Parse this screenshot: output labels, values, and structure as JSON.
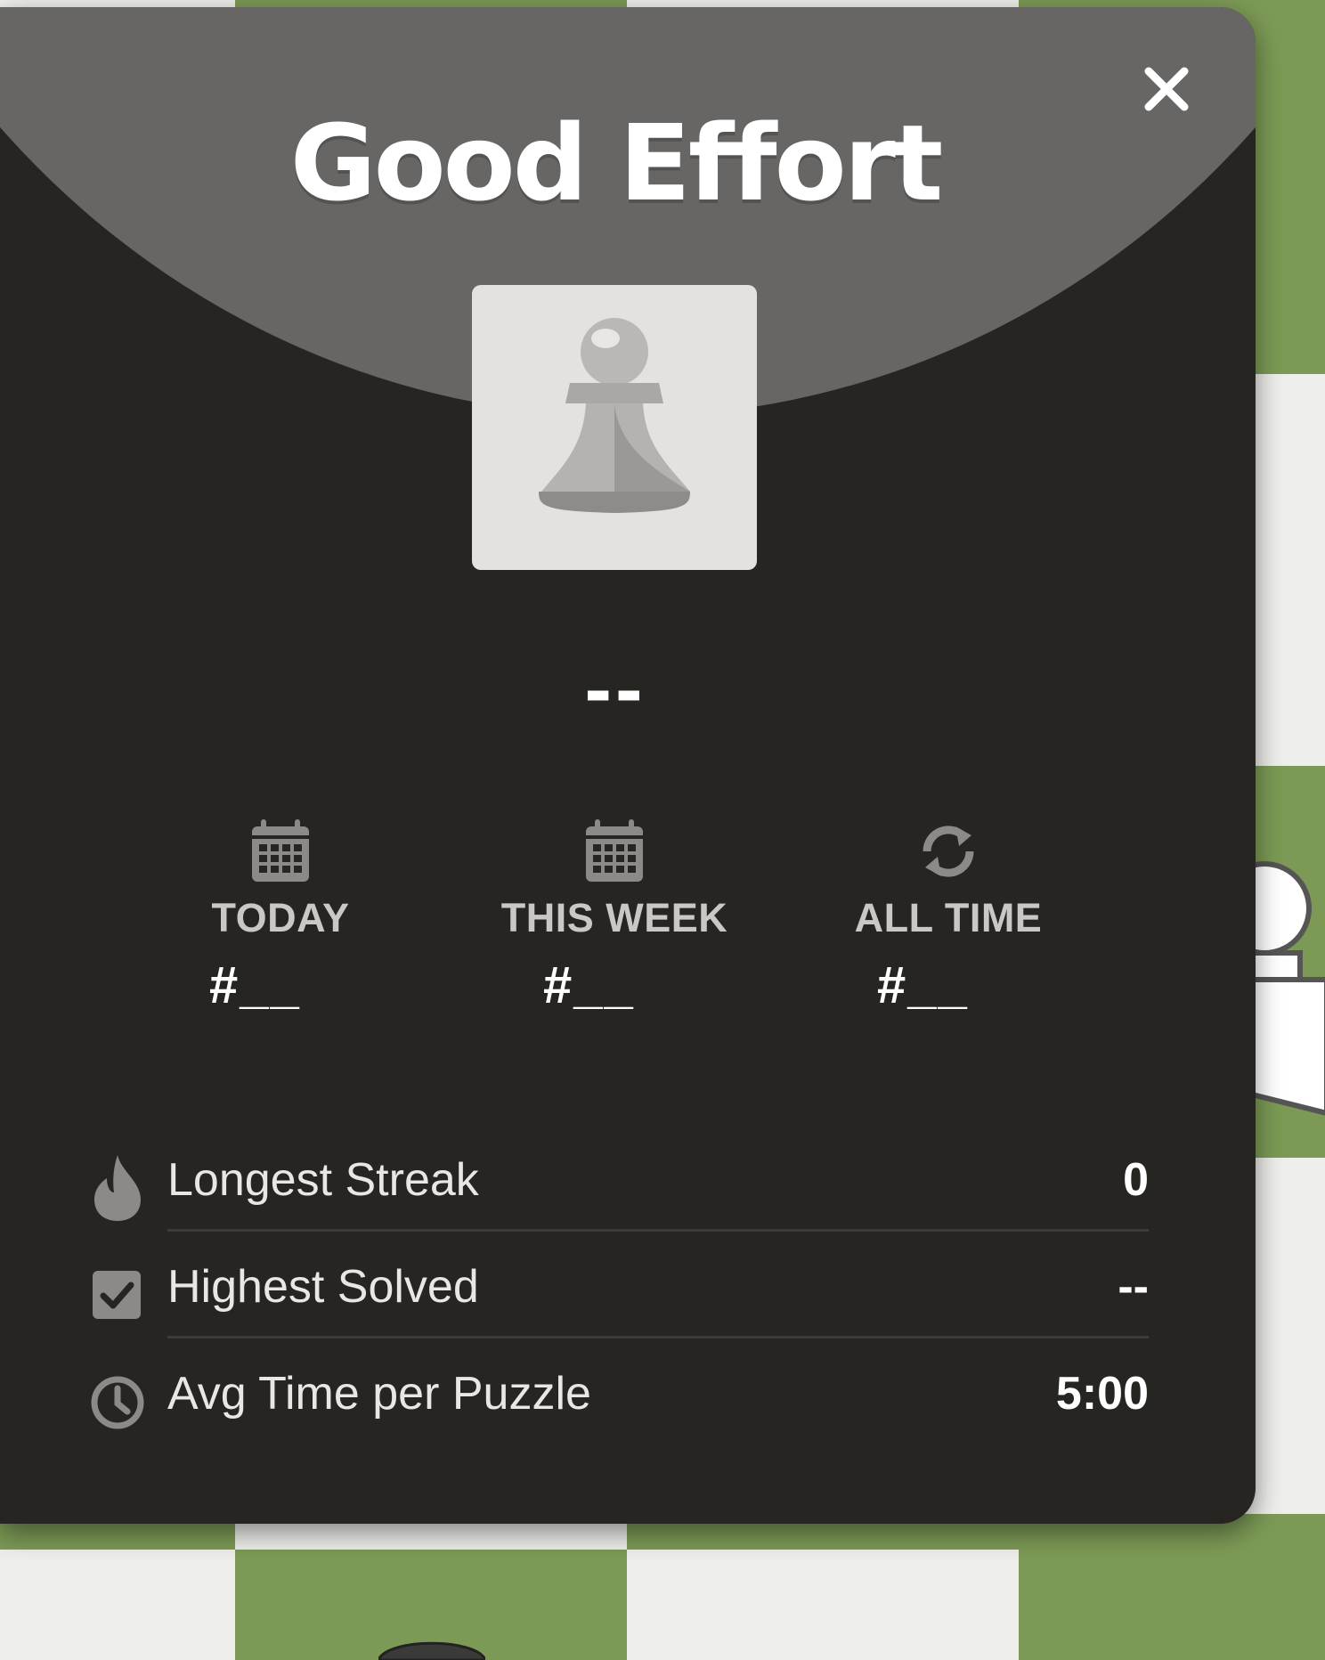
{
  "modal": {
    "title": "Good Effort",
    "rating": "--",
    "close_label": "close",
    "ranks": [
      {
        "label": "TODAY",
        "value": "#__",
        "icon": "calendar-icon"
      },
      {
        "label": "THIS WEEK",
        "value": "#__",
        "icon": "calendar-icon"
      },
      {
        "label": "ALL TIME",
        "value": "#__",
        "icon": "refresh-icon"
      }
    ],
    "stats": [
      {
        "label": "Longest Streak",
        "value": "0",
        "icon": "flame-icon"
      },
      {
        "label": "Highest Solved",
        "value": "--",
        "icon": "checkbox-icon"
      },
      {
        "label": "Avg Time per Puzzle",
        "value": "5:00",
        "icon": "clock-icon"
      }
    ]
  },
  "colors": {
    "board_green": "#7c9a55",
    "board_light": "#eeeeea",
    "modal_bg": "#262522",
    "header_bg": "#676665",
    "icon_gray": "#8b8a88"
  }
}
